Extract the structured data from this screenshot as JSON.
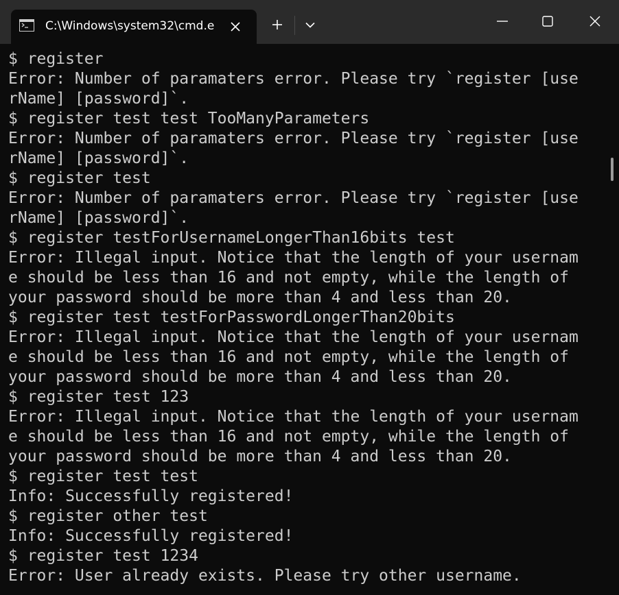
{
  "window": {
    "tab_title": "C:\\Windows\\system32\\cmd.e",
    "new_tab_symbol": "+",
    "icons": {
      "tab": "cmd-prompt-icon",
      "close_tab": "close-icon",
      "new_tab": "plus-icon",
      "dropdown": "chevron-down-icon",
      "minimize": "minimize-icon",
      "maximize": "maximize-icon",
      "close_window": "close-icon"
    },
    "colors": {
      "titlebar": "#2b2b2b",
      "background": "#0c0c0c",
      "text": "#cccccc"
    }
  },
  "terminal": {
    "lines": [
      "$ register",
      "Error: Number of paramaters error. Please try `register [use",
      "rName] [password]`.",
      "$ register test test TooManyParameters",
      "Error: Number of paramaters error. Please try `register [use",
      "rName] [password]`.",
      "$ register test",
      "Error: Number of paramaters error. Please try `register [use",
      "rName] [password]`.",
      "$ register testForUsernameLongerThan16bits test",
      "Error: Illegal input. Notice that the length of your usernam",
      "e should be less than 16 and not empty, while the length of",
      "your password should be more than 4 and less than 20.",
      "$ register test testForPasswordLongerThan20bits",
      "Error: Illegal input. Notice that the length of your usernam",
      "e should be less than 16 and not empty, while the length of",
      "your password should be more than 4 and less than 20.",
      "$ register test 123",
      "Error: Illegal input. Notice that the length of your usernam",
      "e should be less than 16 and not empty, while the length of",
      "your password should be more than 4 and less than 20.",
      "$ register test test",
      "Info: Successfully registered!",
      "$ register other test",
      "Info: Successfully registered!",
      "$ register test 1234",
      "Error: User already exists. Please try other username."
    ]
  }
}
